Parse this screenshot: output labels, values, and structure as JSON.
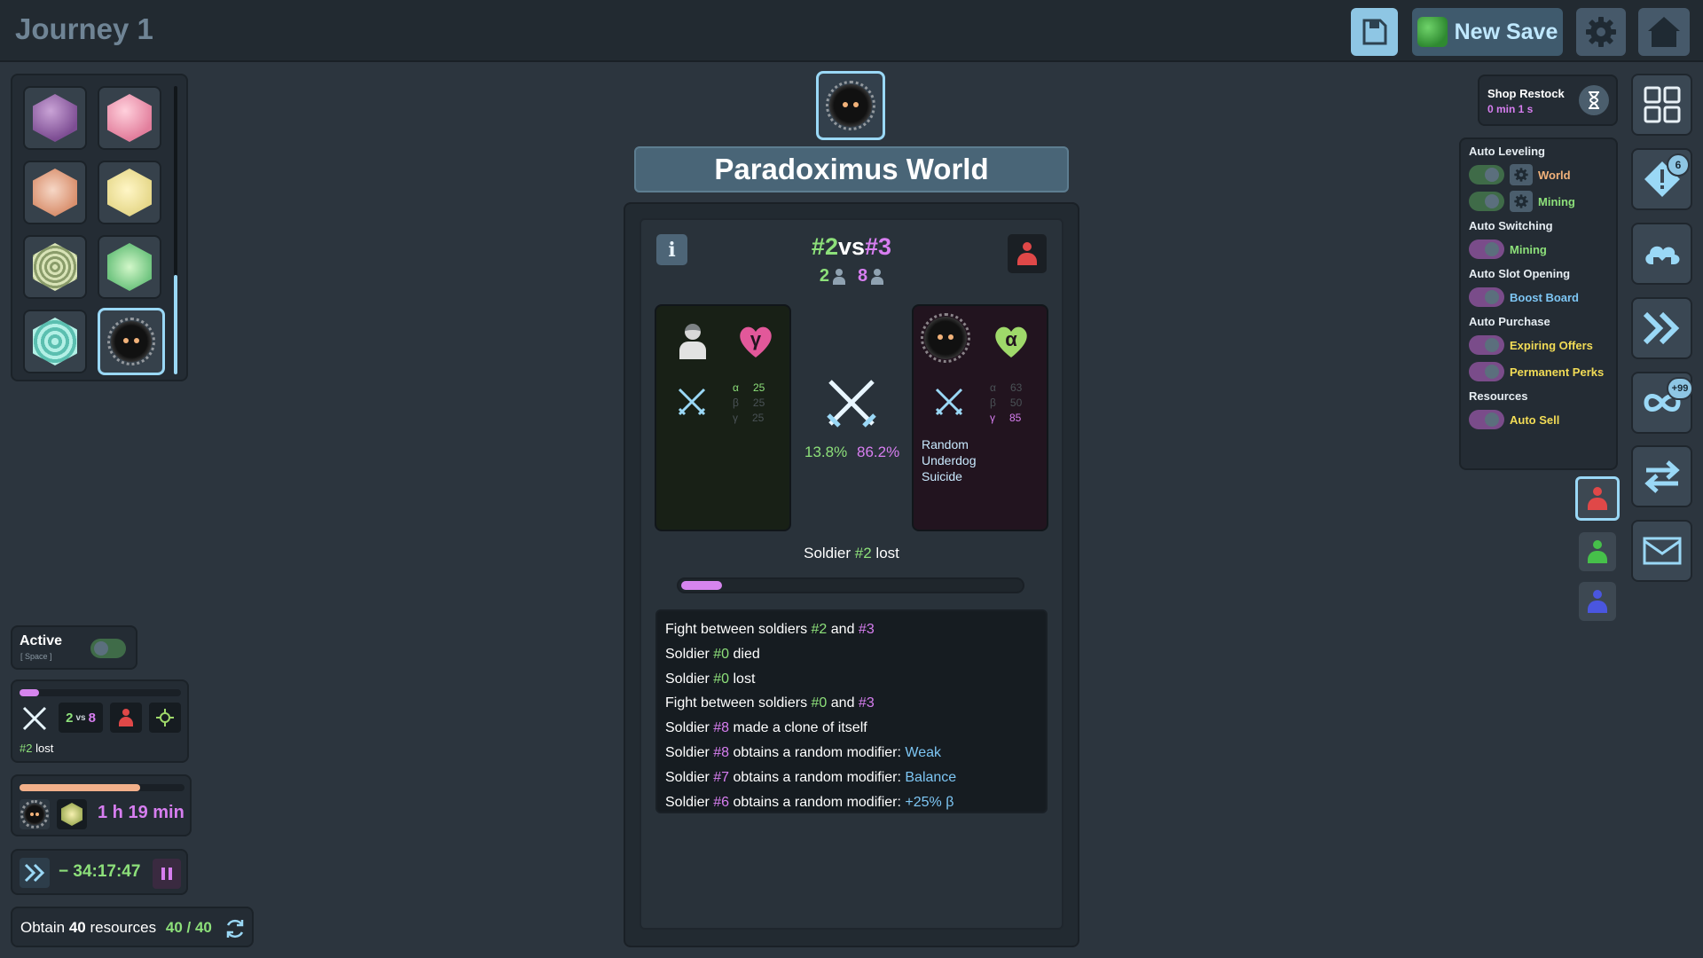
{
  "topbar": {
    "title": "Journey 1",
    "new_save_label": "New Save"
  },
  "battle": {
    "world_name": "Paradoximus World",
    "left_id": "#2",
    "vs": "vs",
    "right_id": "#3",
    "left_count": "2",
    "right_count": "8",
    "left_type": "γ",
    "right_type": "α",
    "left_stats": [
      {
        "label": "α",
        "value": "25"
      },
      {
        "label": "β",
        "value": "25"
      },
      {
        "label": "γ",
        "value": "25"
      }
    ],
    "right_stats": [
      {
        "label": "α",
        "value": "63"
      },
      {
        "label": "β",
        "value": "50"
      },
      {
        "label": "γ",
        "value": "85"
      }
    ],
    "right_modifiers": [
      "Random",
      "Underdog",
      "Suicide"
    ],
    "left_pct": "13.8%",
    "right_pct": "86.2%",
    "result_prefix": "Soldier",
    "result_id": "#2",
    "result_suffix": "lost",
    "progress_fraction": 0.12,
    "colors": {
      "left": "#8de07a",
      "right": "#d77ef0",
      "modifier": "#7dc6f4"
    }
  },
  "log": [
    {
      "parts": [
        {
          "t": "Fight between soldiers ",
          "c": ""
        },
        {
          "t": "#2",
          "c": "c-green"
        },
        {
          "t": " and ",
          "c": ""
        },
        {
          "t": "#3",
          "c": "c-purple"
        }
      ]
    },
    {
      "parts": [
        {
          "t": "Soldier ",
          "c": ""
        },
        {
          "t": "#0",
          "c": "c-green"
        },
        {
          "t": " died",
          "c": ""
        }
      ]
    },
    {
      "parts": [
        {
          "t": "Soldier ",
          "c": ""
        },
        {
          "t": "#0",
          "c": "c-green"
        },
        {
          "t": " lost",
          "c": ""
        }
      ]
    },
    {
      "parts": [
        {
          "t": "Fight between soldiers ",
          "c": ""
        },
        {
          "t": "#0",
          "c": "c-green"
        },
        {
          "t": " and ",
          "c": ""
        },
        {
          "t": "#3",
          "c": "c-purple"
        }
      ]
    },
    {
      "parts": [
        {
          "t": "Soldier ",
          "c": ""
        },
        {
          "t": "#8",
          "c": "c-purple"
        },
        {
          "t": " made a clone of itself",
          "c": ""
        }
      ]
    },
    {
      "parts": [
        {
          "t": "Soldier ",
          "c": ""
        },
        {
          "t": "#8",
          "c": "c-purple"
        },
        {
          "t": " obtains a random modifier: ",
          "c": ""
        },
        {
          "t": "Weak",
          "c": "c-blue"
        }
      ]
    },
    {
      "parts": [
        {
          "t": "Soldier ",
          "c": ""
        },
        {
          "t": "#7",
          "c": "c-purple"
        },
        {
          "t": " obtains a random modifier: ",
          "c": ""
        },
        {
          "t": "Balance",
          "c": "c-blue"
        }
      ]
    },
    {
      "parts": [
        {
          "t": "Soldier ",
          "c": ""
        },
        {
          "t": "#6",
          "c": "c-purple"
        },
        {
          "t": " obtains a random modifier: ",
          "c": ""
        },
        {
          "t": "+25% β",
          "c": "c-blue"
        }
      ]
    }
  ],
  "left_panels": {
    "active_label": "Active",
    "active_hint": "[ Space ]",
    "fight_left": "2",
    "fight_vs": "vs",
    "fight_right": "8",
    "fight_id": "#2",
    "fight_status": "lost",
    "fight_progress_fraction": 0.12,
    "mining_time": "1 h 19 min",
    "mining_progress_fraction": 0.73,
    "timer": "− 34:17:47",
    "goal_prefix": "Obtain",
    "goal_amount": "40",
    "goal_suffix": "resources",
    "goal_progress": "40 / 40"
  },
  "shop": {
    "label": "Shop Restock",
    "time": "0 min 1 s"
  },
  "automation": {
    "sections": [
      {
        "title": "Auto Leveling",
        "rows": [
          {
            "label": "World",
            "color": "#f2b27a",
            "gear": true,
            "toggle_color": "#3f6b48",
            "knob": "#5b6f7d"
          },
          {
            "label": "Mining",
            "color": "#8de07a",
            "gear": true,
            "toggle_color": "#3f6b48",
            "knob": "#5b6f7d"
          }
        ]
      },
      {
        "title": "Auto Switching",
        "rows": [
          {
            "label": "Mining",
            "color": "#8de07a",
            "gear": false,
            "toggle_color": "#7a4c8a",
            "knob": "#5b6f7d"
          }
        ]
      },
      {
        "title": "Auto Slot Opening",
        "rows": [
          {
            "label": "Boost Board",
            "color": "#7dc6f4",
            "gear": false,
            "toggle_color": "#7a4c8a",
            "knob": "#5b6f7d"
          }
        ]
      },
      {
        "title": "Auto Purchase",
        "rows": [
          {
            "label": "Expiring Offers",
            "color": "#f2dc56",
            "gear": false,
            "toggle_color": "#7a4c8a",
            "knob": "#5b6f7d"
          },
          {
            "label": "Permanent Perks",
            "color": "#f2dc56",
            "gear": false,
            "toggle_color": "#7a4c8a",
            "knob": "#5b6f7d"
          }
        ]
      },
      {
        "title": "Resources",
        "rows": [
          {
            "label": "Auto Sell",
            "color": "#f2dc56",
            "gear": false,
            "toggle_color": "#7a4c8a",
            "knob": "#5b6f7d"
          }
        ]
      }
    ]
  },
  "side_buttons": {
    "alerts_badge": "6",
    "infinity_badge": "+99"
  },
  "icons": {
    "save": "floppy-disk-icon",
    "settings": "gear-icon",
    "home": "house-icon",
    "grid": "grid-icon",
    "alert": "alert-diamond-icon",
    "cloud": "cloud-icon",
    "fast_forward": "fast-forward-icon",
    "infinity": "infinity-icon",
    "swap": "swap-arrows-icon",
    "mail": "envelope-icon"
  }
}
